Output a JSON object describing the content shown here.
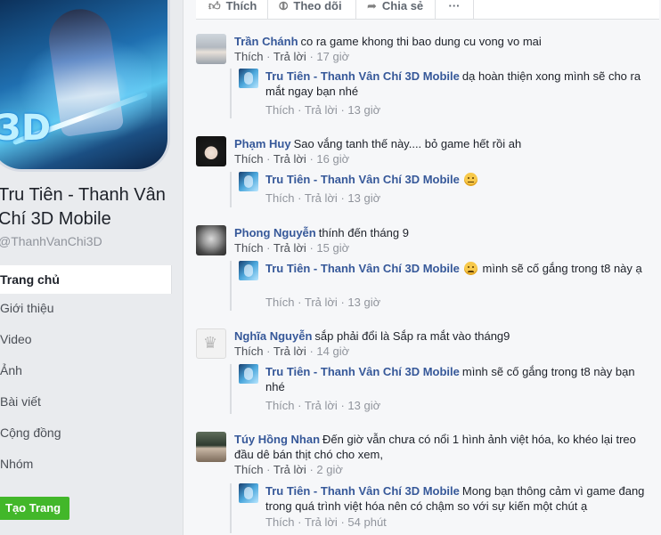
{
  "sidebar": {
    "page_name": "Tru Tiên - Thanh Vân Chí 3D Mobile",
    "handle": "@ThanhVanChi3D",
    "nav": [
      "Trang chủ",
      "Giới thiệu",
      "Video",
      "Ảnh",
      "Bài viết",
      "Cộng đồng",
      "Nhóm"
    ],
    "active_nav": "Trang chủ",
    "create_page_label": "Tạo Trang"
  },
  "actions": {
    "like": "Thích",
    "follow": "Theo dõi",
    "share": "Chia sẻ",
    "more": "···"
  },
  "labels": {
    "like": "Thích",
    "reply": "Trả lời",
    "sep": "·"
  },
  "comments": [
    {
      "author": "Trần Chánh",
      "text": "co ra game khong thi bao dung cu vong vo mai",
      "time": "17 giờ",
      "reply": {
        "author": "Tru Tiên - Thanh Vân Chí 3D Mobile",
        "text": "dạ hoàn thiện xong mình sẽ cho ra mắt ngay bạn nhé",
        "time": "13 giờ"
      }
    },
    {
      "author": "Phạm Huy",
      "text": "Sao vắng tanh thế này.... bỏ game hết rồi ah",
      "time": "16 giờ",
      "reply": {
        "author": "Tru Tiên - Thanh Vân Chí 3D Mobile",
        "text": "",
        "emoji": "neutral-face",
        "time": "13 giờ"
      }
    },
    {
      "author": "Phong Nguyễn",
      "text": "thính đến tháng 9",
      "time": "15 giờ",
      "reply": {
        "author": "Tru Tiên - Thanh Vân Chí 3D Mobile",
        "text": "mình sẽ cố gắng trong t8 này ạ",
        "emoji": "sad-face",
        "time": "13 giờ"
      }
    },
    {
      "author": "Nghĩa Nguyễn",
      "text": "sắp phải đổi là Sắp ra mắt vào tháng9",
      "time": "14 giờ",
      "reply": {
        "author": "Tru Tiên - Thanh Vân Chí 3D Mobile",
        "text": "mình sẽ cố gắng trong t8 này bạn nhé",
        "time": "13 giờ"
      }
    },
    {
      "author": "Túy Hồng Nhan",
      "text": "Đến giờ vẫn chưa có nổi 1 hình ảnh việt hóa, ko khéo lại treo đầu dê bán thịt chó cho xem,",
      "time": "2 giờ",
      "reply": {
        "author": "Tru Tiên - Thanh Vân Chí 3D Mobile",
        "text": "Mong bạn thông cảm vì game đang trong quá trình việt hóa nên có chậm so với sự kiến một chút ạ",
        "time": "54 phút"
      }
    }
  ]
}
